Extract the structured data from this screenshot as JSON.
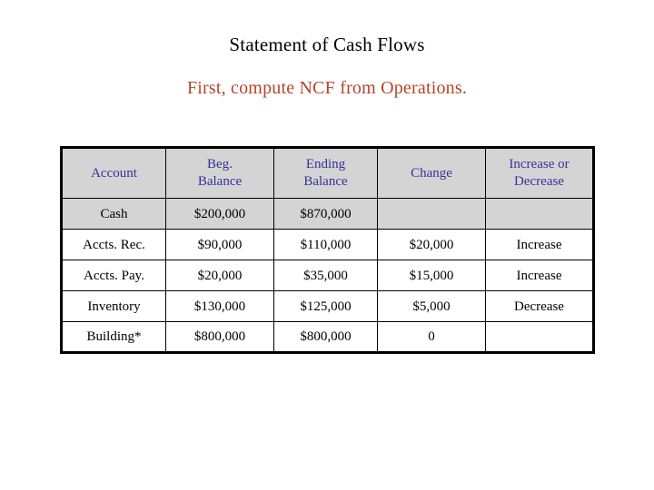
{
  "slide": {
    "title": "Statement of Cash Flows",
    "subtitle": "First, compute NCF from Operations.",
    "title_color": "#000000",
    "subtitle_color": "#b5432a",
    "background_color": "#ffffff"
  },
  "table": {
    "header_text_color": "#333399",
    "header_fill_color": "#d4d4d4",
    "accent_text_color": "#b5432a",
    "border_color": "#000000",
    "columns": [
      {
        "label": "Account"
      },
      {
        "label": "Beg. Balance",
        "line1": "Beg.",
        "line2": "Balance"
      },
      {
        "label": "Ending Balance",
        "line1": "Ending",
        "line2": "Balance"
      },
      {
        "label": "Change",
        "line1": "Change",
        "line2": ""
      },
      {
        "label": "Increase or Decrease",
        "line1": "Increase or",
        "line2": "Decrease"
      }
    ],
    "rows": [
      {
        "account": "Cash",
        "beg_balance": "$200,000",
        "ending_balance": "$870,000",
        "change": "",
        "increase_or_decrease": "",
        "shaded": true
      },
      {
        "account": "Accts. Rec.",
        "beg_balance": "$90,000",
        "ending_balance": "$110,000",
        "change": "$20,000",
        "increase_or_decrease": "Increase",
        "shaded": false
      },
      {
        "account": "Accts. Pay.",
        "beg_balance": "$20,000",
        "ending_balance": "$35,000",
        "change": "$15,000",
        "increase_or_decrease": "Increase",
        "shaded": false
      },
      {
        "account": "Inventory",
        "beg_balance": "$130,000",
        "ending_balance": "$125,000",
        "change": "$5,000",
        "increase_or_decrease": "Decrease",
        "shaded": false
      },
      {
        "account": "Building*",
        "beg_balance": "$800,000",
        "ending_balance": "$800,000",
        "change": "0",
        "increase_or_decrease": "",
        "shaded": false
      }
    ]
  }
}
